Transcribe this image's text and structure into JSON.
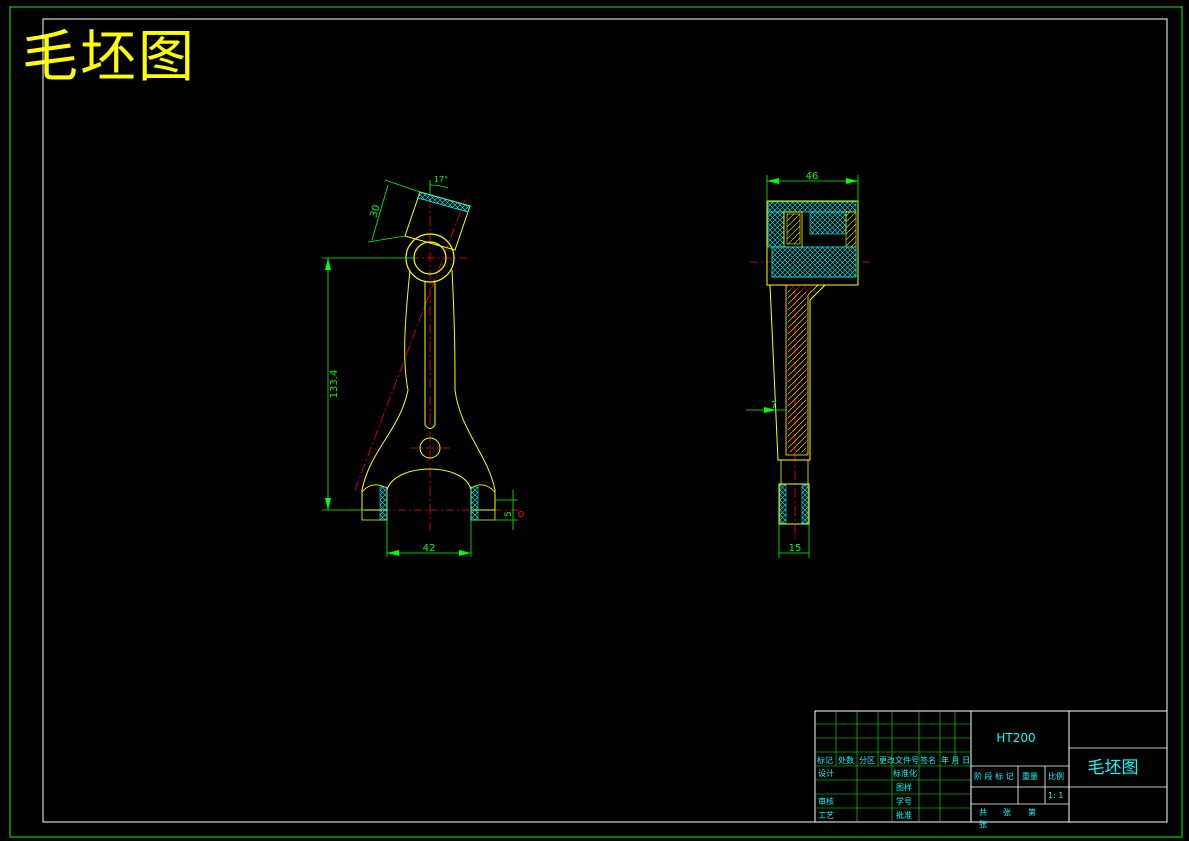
{
  "title": "毛坯图",
  "colors": {
    "background": "#000000",
    "frame": "#00ff00",
    "outline": "#ffff00",
    "dimension": "#00ff00",
    "centerline": "#ff0000",
    "hatch": "#00ffff",
    "title_text": "#ffff00",
    "table_text": "#00ffff",
    "cross_section_hatch": "#ff0000"
  },
  "front_view": {
    "dimensions": {
      "height": "133.4",
      "bottom_width": "42",
      "top_tilt": "30",
      "top_angle": "17°",
      "bottom_offset": "5"
    }
  },
  "side_view": {
    "dimensions": {
      "top_width": "46",
      "bottom_width": "15",
      "taper": "7"
    }
  },
  "title_block": {
    "material": "HT200",
    "drawing_name": "毛坯图",
    "header_labels": [
      "标记",
      "处数",
      "分区",
      "更改文件号",
      "签名",
      "年 月 日"
    ],
    "row_labels_left": [
      "设计",
      "审核",
      "工艺"
    ],
    "row_labels_mid": [
      "标准化",
      "批准"
    ],
    "stage_labels": [
      "阶 段 标 记",
      "重量",
      "比例"
    ],
    "scale": "1: 1",
    "sheet_info": {
      "total": "共",
      "sheet": "张",
      "page": "第"
    },
    "extra_labels": [
      "图样",
      "学号"
    ]
  }
}
